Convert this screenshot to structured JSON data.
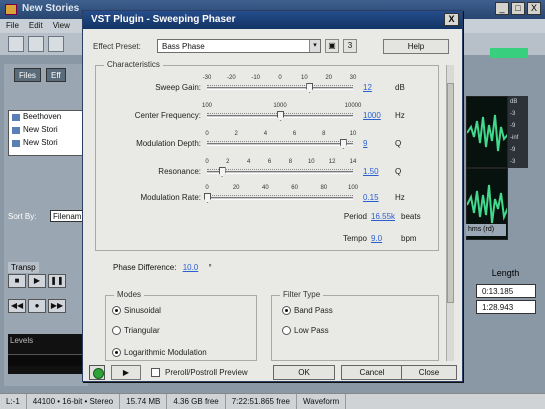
{
  "host": {
    "title": "New Stories",
    "menu": [
      "File",
      "Edit",
      "View"
    ],
    "files_tab": "Files",
    "effects_tab": "Eff",
    "files": [
      "Beethoven",
      "New Stori",
      "New Stori"
    ],
    "sort_label": "Sort By:",
    "sort_value": "Filenam",
    "transport_label": "Transp",
    "levels_label": "Levels",
    "db_marks": [
      "dB",
      "-3",
      "-9",
      "-inf",
      "-9",
      "-3"
    ],
    "time_header": "Length",
    "times": [
      "0:13.185",
      "1:28.943"
    ],
    "hms_label": "hms (rd)",
    "win_min": "_",
    "win_max": "□",
    "win_close": "X"
  },
  "status": {
    "cells": [
      "L:-1",
      "44100 • 16-bit • Stereo",
      "15.74 MB",
      "4.36 GB free",
      "7:22:51.865 free",
      "Waveform"
    ]
  },
  "dialog": {
    "title": "VST Plugin - Sweeping Phaser",
    "close": "X",
    "preset_label": "Effect Preset:",
    "preset_value": "Bass Phase",
    "preset_arrow": "▾",
    "help": "Help",
    "characteristics_label": "Characteristics",
    "sliders": [
      {
        "label": "Sweep Gain:",
        "value": "12",
        "unit": "dB",
        "scale": [
          "-30",
          "-20",
          "-10",
          "0",
          "10",
          "20",
          "30"
        ],
        "position": 0.7
      },
      {
        "label": "Center Frequency:",
        "value": "1000",
        "unit": "Hz",
        "scale": [
          "100",
          "1000",
          "10000"
        ],
        "position": 0.5
      },
      {
        "label": "Modulation Depth:",
        "value": "9",
        "unit": "Q",
        "scale": [
          "0",
          "2",
          "4",
          "6",
          "8",
          "10"
        ],
        "position": 0.93
      },
      {
        "label": "Resonance:",
        "value": "1.50",
        "unit": "Q",
        "scale": [
          "0",
          "2",
          "4",
          "6",
          "8",
          "10",
          "12",
          "14"
        ],
        "position": 0.1
      },
      {
        "label": "Modulation Rate:",
        "value": "0.15",
        "unit": "Hz",
        "scale": [
          "0",
          "20",
          "40",
          "60",
          "80",
          "100"
        ],
        "position": 0.0
      }
    ],
    "period_label": "Period",
    "period_value": "16.55k",
    "period_unit": "beats",
    "tempo_label": "Tempo",
    "tempo_value": "9.0",
    "tempo_unit": "bpm",
    "phase_label": "Phase Difference:",
    "phase_value": "10.0",
    "phase_unit": "°",
    "modes_label": "Modes",
    "modes": [
      {
        "label": "Sinusoidal",
        "selected": true
      },
      {
        "label": "Triangular",
        "selected": false
      },
      {
        "label": "Logarithmic Modulation",
        "selected": true
      }
    ],
    "filter_label": "Filter Type",
    "filters": [
      {
        "label": "Band Pass",
        "selected": true
      },
      {
        "label": "Low Pass",
        "selected": false
      }
    ],
    "play": "▶",
    "preroll_label": "Preroll/Postroll Preview",
    "ok": "OK",
    "cancel": "Cancel",
    "close_btn": "Close"
  }
}
